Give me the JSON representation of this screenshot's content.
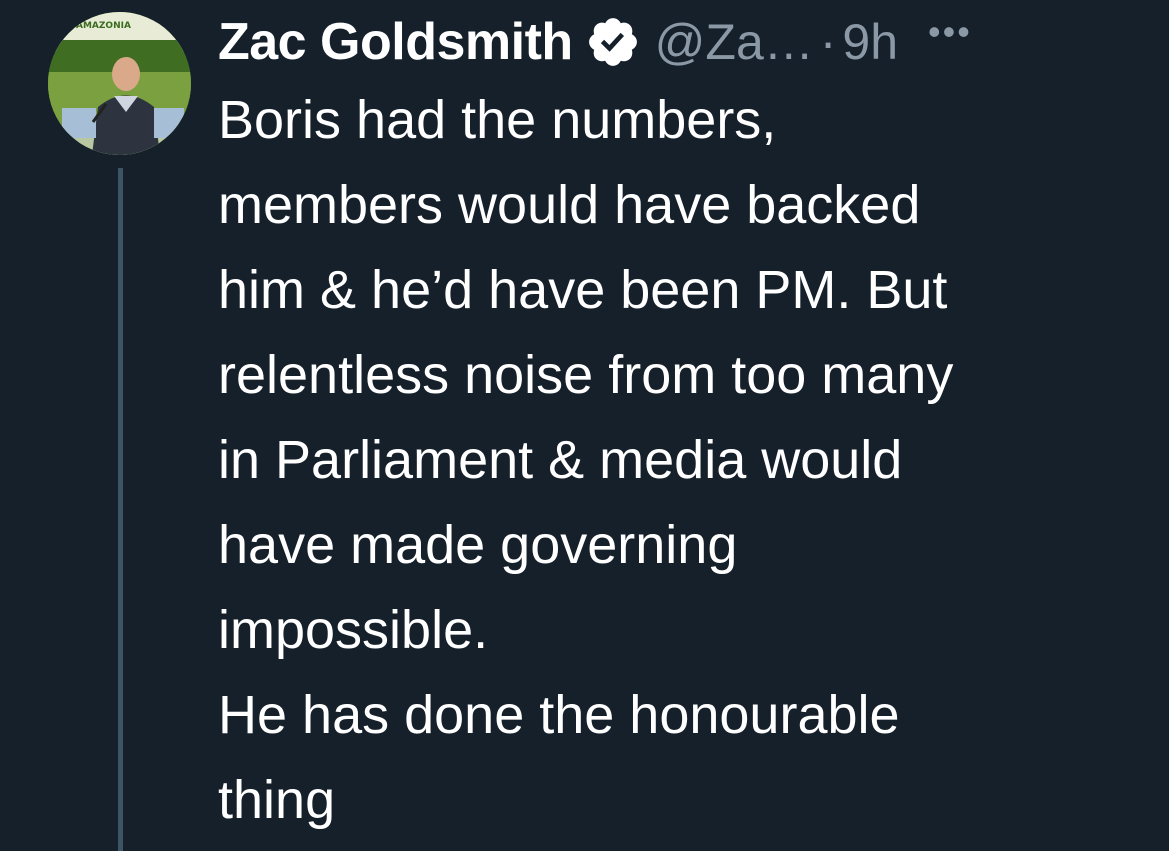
{
  "author": {
    "name": "Zac Goldsmith",
    "handle": "@Za…",
    "separator": "·",
    "time": "9h",
    "avatar_text": "AMAZONIA"
  },
  "icons": {
    "verified": "verified-badge-icon",
    "more": "more-options-icon"
  },
  "tweet": {
    "text": "Boris had the numbers,\nmembers would have backed\nhim & he’d have been PM. But\nrelentless noise from too many\nin Parliament & media would\nhave made governing\nimpossible.\nHe has done the honourable\nthing"
  },
  "colors": {
    "background": "#15202b",
    "text": "#ffffff",
    "secondary": "#8b98a5",
    "thread_line": "#3d5466"
  }
}
